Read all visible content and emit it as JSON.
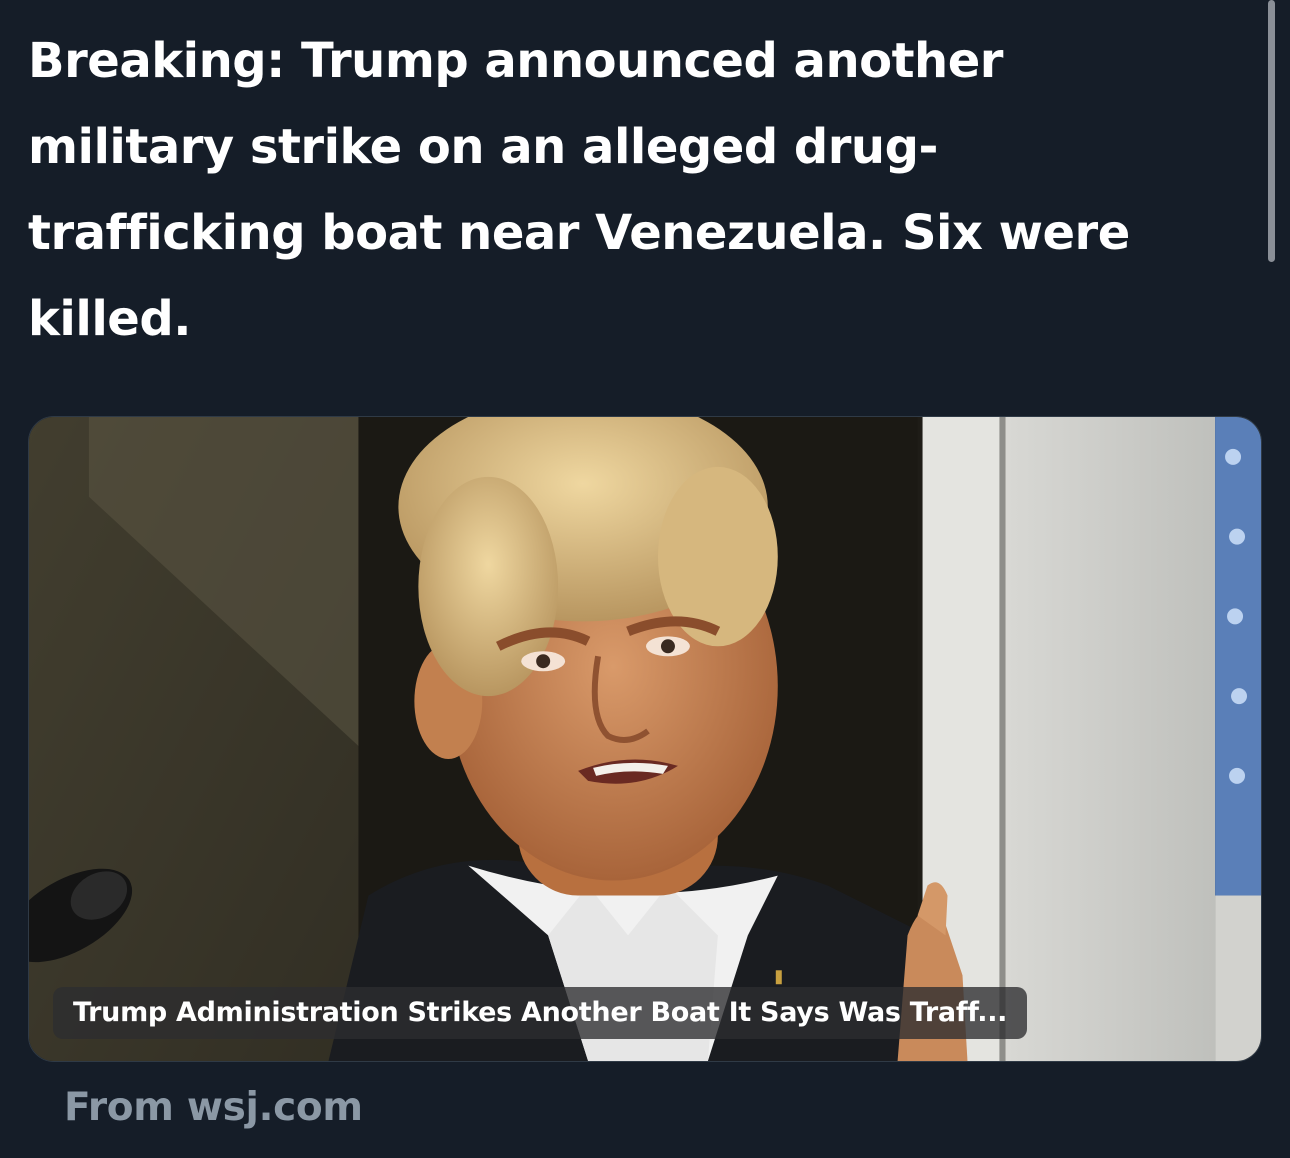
{
  "tweet": {
    "text": "Breaking: Trump announced another military strike on an alleged drug-trafficking boat near Venezuela. Six were killed."
  },
  "link_card": {
    "headline": "Trump Administration Strikes Another Boat It Says Was Traff...",
    "image_icon": "news-photo-icon",
    "source_text": "From wsj.com"
  },
  "colors": {
    "background": "#151d28",
    "text": "#ffffff",
    "muted_text": "#8b98a5"
  }
}
